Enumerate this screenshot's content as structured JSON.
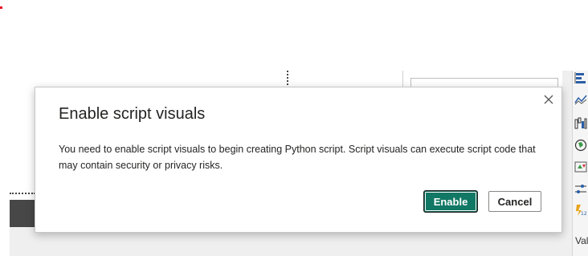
{
  "dialog": {
    "title": "Enable script visuals",
    "message": "You need to enable script visuals to begin creating Python script. Script visuals can execute script code that may contain security or privacy risks.",
    "enable_label": "Enable",
    "cancel_label": "Cancel",
    "close_icon": "close-icon"
  },
  "visualizations_pane": {
    "icons": [
      "stacked-bar-icon",
      "line-chart-icon",
      "waterfall-icon",
      "map-icon",
      "kpi-icon",
      "slicer-icon",
      "card-icon"
    ],
    "truncated_label": "Val"
  },
  "colors": {
    "primary": "#117865",
    "text": "#252423"
  }
}
